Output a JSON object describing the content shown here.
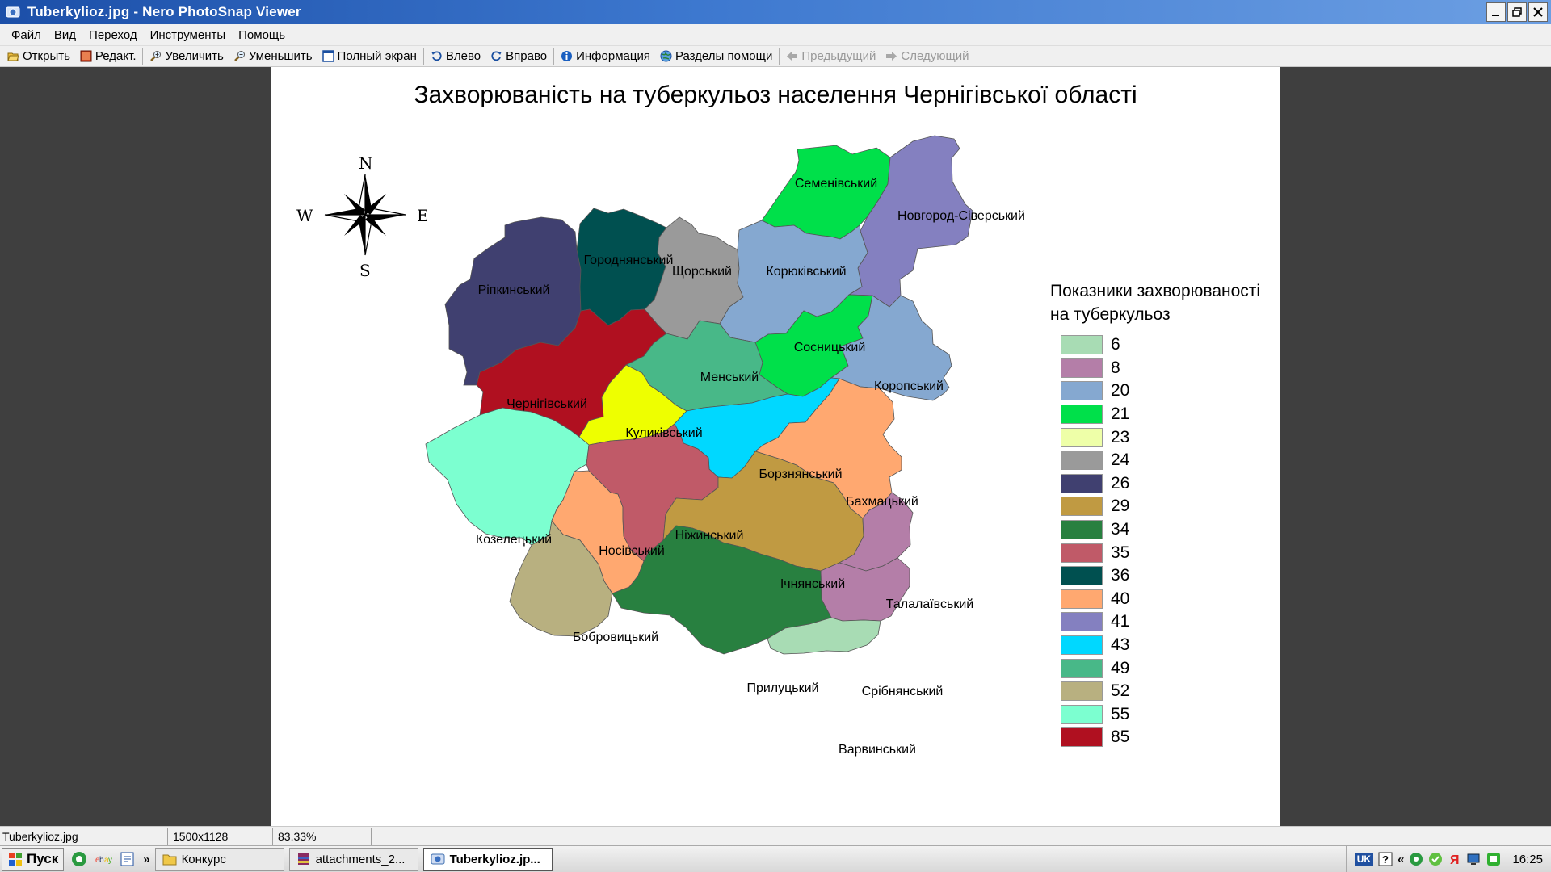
{
  "window": {
    "title": "Tuberkylioz.jpg - Nero PhotoSnap Viewer"
  },
  "menu": [
    "Файл",
    "Вид",
    "Переход",
    "Инструменты",
    "Помощь"
  ],
  "toolbar": {
    "open": "Открыть",
    "edit": "Редакт.",
    "zoom_in": "Увеличить",
    "zoom_out": "Уменьшить",
    "fullscreen": "Полный экран",
    "rotate_left": "Влево",
    "rotate_right": "Вправо",
    "info": "Информация",
    "help": "Разделы помощи",
    "previous": "Предыдущий",
    "next": "Следующий"
  },
  "image": {
    "title": "Захворюваність на туберкульоз населення Чернігівської області",
    "compass": {
      "n": "N",
      "s": "S",
      "w": "W",
      "e": "E"
    },
    "legend_title": "Показники захворюваності на туберкульоз",
    "legend": [
      {
        "value": "6",
        "color": "#a8dcb4"
      },
      {
        "value": "8",
        "color": "#b47ea8"
      },
      {
        "value": "20",
        "color": "#85a8d0"
      },
      {
        "value": "21",
        "color": "#00e04a"
      },
      {
        "value": "23",
        "color": "#eeffa8"
      },
      {
        "value": "24",
        "color": "#9a9a9a"
      },
      {
        "value": "26",
        "color": "#404070"
      },
      {
        "value": "29",
        "color": "#c09a42"
      },
      {
        "value": "34",
        "color": "#288040"
      },
      {
        "value": "35",
        "color": "#c05a68"
      },
      {
        "value": "36",
        "color": "#005050"
      },
      {
        "value": "40",
        "color": "#ffa870"
      },
      {
        "value": "41",
        "color": "#8480c0"
      },
      {
        "value": "43",
        "color": "#00d8ff"
      },
      {
        "value": "49",
        "color": "#48b888"
      },
      {
        "value": "52",
        "color": "#b8b080"
      },
      {
        "value": "55",
        "color": "#7cffd0"
      },
      {
        "value": "85",
        "color": "#b01020"
      }
    ],
    "districts": [
      {
        "id": "semenivskyi",
        "name": "Семенівський",
        "value": 21
      },
      {
        "id": "novgorod",
        "name": "Новгород-Сіверський",
        "value": 41
      },
      {
        "id": "ripkynskyi",
        "name": "Ріпкинський",
        "value": 26
      },
      {
        "id": "horodnianskyi",
        "name": "Городнянський",
        "value": 36
      },
      {
        "id": "shchorskyi",
        "name": "Щорський",
        "value": 24
      },
      {
        "id": "koriukivskyi",
        "name": "Корюківський",
        "value": 20
      },
      {
        "id": "sosnytskyi",
        "name": "Сосницький",
        "value": 21
      },
      {
        "id": "koropskyi",
        "name": "Коропський",
        "value": 20
      },
      {
        "id": "chernihivskyi",
        "name": "Чернігівський",
        "value": 85
      },
      {
        "id": "menskyi",
        "name": "Менський",
        "value": 49
      },
      {
        "id": "kulykivskyi",
        "name": "Куликівський",
        "value": 23
      },
      {
        "id": "borznianskyi",
        "name": "Борзнянський",
        "value": 43
      },
      {
        "id": "bakhmatskyi",
        "name": "Бахмацький",
        "value": 40
      },
      {
        "id": "kozeletskyi",
        "name": "Козелецький",
        "value": 55
      },
      {
        "id": "nosivskyi",
        "name": "Носівський",
        "value": 40
      },
      {
        "id": "nizhynskyi",
        "name": "Ніжинський",
        "value": 35
      },
      {
        "id": "ichnianskyi",
        "name": "Ічнянський",
        "value": 29
      },
      {
        "id": "talalaivskyi",
        "name": "Талалаївський",
        "value": 8
      },
      {
        "id": "bobrovytskyi",
        "name": "Бобровицький",
        "value": 52
      },
      {
        "id": "sribnianskyi",
        "name": "Срібнянський",
        "value": 8
      },
      {
        "id": "prylutskyi",
        "name": "Прилуцький",
        "value": 34
      },
      {
        "id": "varvynskyi",
        "name": "Варвинський",
        "value": 6
      }
    ]
  },
  "status": {
    "filename": "Tuberkylioz.jpg",
    "dimensions": "1500x1128",
    "zoom": "83.33%"
  },
  "taskbar": {
    "start": "Пуск",
    "tasks": [
      "Конкурс",
      "attachments_2...",
      "Tuberkylioz.jp..."
    ],
    "lang": "UK",
    "clock": "16:25"
  }
}
